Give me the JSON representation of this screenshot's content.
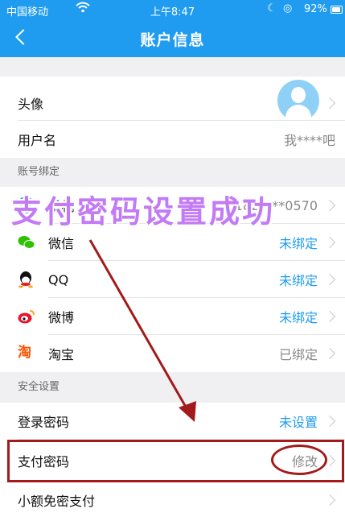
{
  "status_bar": {
    "carrier": "中国移动",
    "time": "上午8:47",
    "battery": "92%",
    "battery_level": 0.92
  },
  "nav": {
    "title": "账户信息"
  },
  "profile": {
    "avatar_label": "头像",
    "username_label": "用户名",
    "username_value": "我****吧"
  },
  "binding": {
    "section_title": "账号绑定",
    "items": [
      {
        "label": "手机",
        "value": "182****0570",
        "icon": "phone-icon"
      },
      {
        "label": "微信",
        "value": "未绑定",
        "icon": "wechat-icon"
      },
      {
        "label": "QQ",
        "value": "未绑定",
        "icon": "qq-icon"
      },
      {
        "label": "微博",
        "value": "未绑定",
        "icon": "weibo-icon"
      },
      {
        "label": "淘宝",
        "value": "已绑定",
        "icon": "taobao-icon"
      }
    ]
  },
  "security": {
    "section_title": "安全设置",
    "items": [
      {
        "label": "登录密码",
        "value": "未设置"
      },
      {
        "label": "支付密码",
        "value": "修改"
      },
      {
        "label": "小额免密支付",
        "value": ""
      }
    ]
  },
  "annotation": {
    "overlay_text": "支付密码设置成功",
    "color": "#c37bf5",
    "marker_color": "#a31a1a"
  },
  "colors": {
    "accent": "#1f9cf0",
    "background": "#f0f0f3"
  }
}
